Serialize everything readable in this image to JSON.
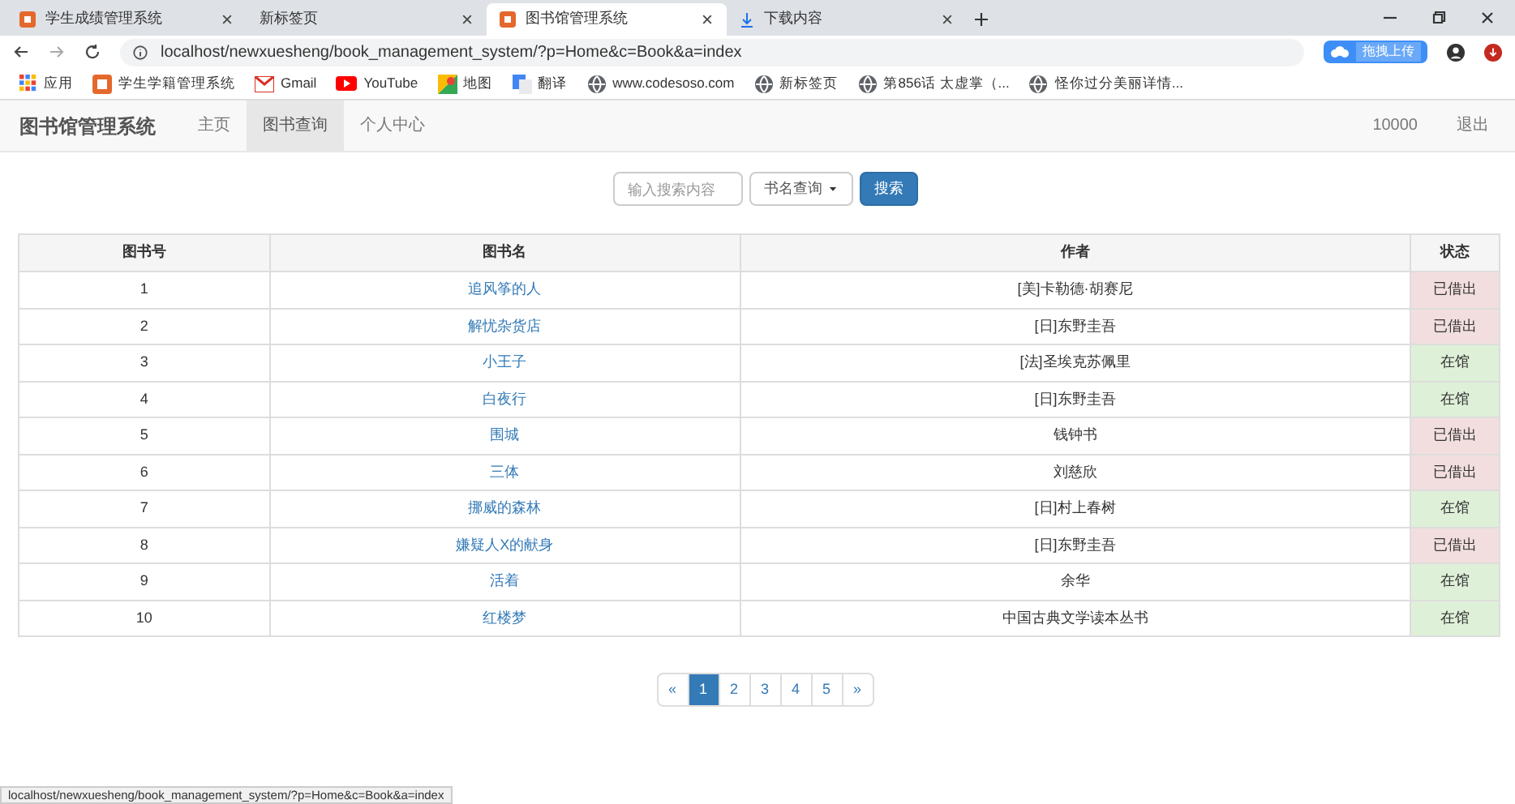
{
  "browser_tabs": [
    {
      "title": "学生成绩管理系统",
      "selected": false
    },
    {
      "title": "新标签页",
      "selected": false
    },
    {
      "title": "图书馆管理系统",
      "selected": true
    },
    {
      "title": "下载内容",
      "selected": false
    }
  ],
  "address": "localhost/newxuesheng/book_management_system/?p=Home&c=Book&a=index",
  "upload_widget": "拖拽上传",
  "bookmarks": [
    {
      "label": "应用",
      "kind": "apps"
    },
    {
      "label": "学生学籍管理系统",
      "kind": "app"
    },
    {
      "label": "Gmail",
      "kind": "gmail"
    },
    {
      "label": "YouTube",
      "kind": "youtube"
    },
    {
      "label": "地图",
      "kind": "maps"
    },
    {
      "label": "翻译",
      "kind": "translate"
    },
    {
      "label": "www.codesoso.com",
      "kind": "globe"
    },
    {
      "label": "新标签页",
      "kind": "globe"
    },
    {
      "label": "第856话 太虚掌（...",
      "kind": "globe"
    },
    {
      "label": "怪你过分美丽详情...",
      "kind": "globe"
    }
  ],
  "navbar": {
    "brand": "图书馆管理系统",
    "items": [
      {
        "label": "主页",
        "selected": false
      },
      {
        "label": "图书查询",
        "selected": true
      },
      {
        "label": "个人中心",
        "selected": false
      }
    ],
    "user": "10000",
    "logout": "退出"
  },
  "search": {
    "placeholder": "输入搜索内容",
    "select": "书名查询",
    "button": "搜索"
  },
  "table": {
    "columns": [
      "图书号",
      "图书名",
      "作者",
      "状态"
    ],
    "rows": [
      {
        "id": "1",
        "title": "追风筝的人",
        "author": "[美]卡勒德·胡赛尼",
        "status": "已借出",
        "kind": "borrowed"
      },
      {
        "id": "2",
        "title": "解忧杂货店",
        "author": "[日]东野圭吾",
        "status": "已借出",
        "kind": "borrowed"
      },
      {
        "id": "3",
        "title": "小王子",
        "author": "[法]圣埃克苏佩里",
        "status": "在馆",
        "kind": "available"
      },
      {
        "id": "4",
        "title": "白夜行",
        "author": "[日]东野圭吾",
        "status": "在馆",
        "kind": "available"
      },
      {
        "id": "5",
        "title": "围城",
        "author": "钱钟书",
        "status": "已借出",
        "kind": "borrowed"
      },
      {
        "id": "6",
        "title": "三体",
        "author": "刘慈欣",
        "status": "已借出",
        "kind": "borrowed"
      },
      {
        "id": "7",
        "title": "挪威的森林",
        "author": "[日]村上春树",
        "status": "在馆",
        "kind": "available"
      },
      {
        "id": "8",
        "title": "嫌疑人X的献身",
        "author": "[日]东野圭吾",
        "status": "已借出",
        "kind": "borrowed"
      },
      {
        "id": "9",
        "title": "活着",
        "author": "余华",
        "status": "在馆",
        "kind": "available"
      },
      {
        "id": "10",
        "title": "红楼梦",
        "author": "中国古典文学读本丛书",
        "status": "在馆",
        "kind": "available"
      }
    ]
  },
  "pagination": [
    {
      "label": "«",
      "selected": false
    },
    {
      "label": "1",
      "selected": true
    },
    {
      "label": "2",
      "selected": false
    },
    {
      "label": "3",
      "selected": false
    },
    {
      "label": "4",
      "selected": false
    },
    {
      "label": "5",
      "selected": false
    },
    {
      "label": "»",
      "selected": false
    }
  ],
  "status_bar": "localhost/newxuesheng/book_management_system/?p=Home&c=Book&a=index"
}
